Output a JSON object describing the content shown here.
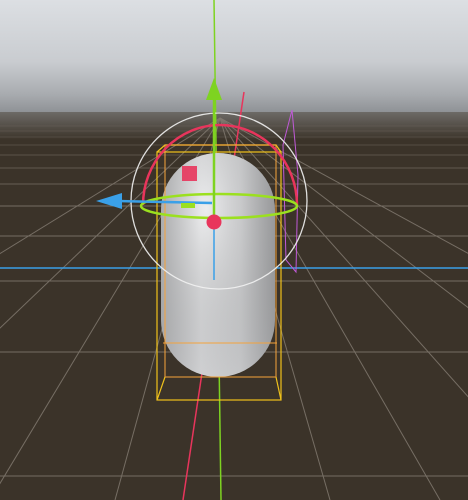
{
  "viewport": {
    "view": "scene-view-3d",
    "object": "capsule",
    "tool": "transform-gizmo",
    "colors": {
      "sky_top": "#dcdfe3",
      "sky_horizon": "#8f9296",
      "ground": "#3b3329",
      "grid_line": "#8a8278",
      "capsule": "#dfe0e2",
      "bounds": "#f0c21c",
      "axis_x": "#e8355c",
      "axis_y": "#7ed321",
      "axis_z": "#3aa0e8",
      "rotate_ring": "#f2f2f2",
      "handle_square": "#e8355c",
      "side_plane": "#c05ad8"
    }
  }
}
